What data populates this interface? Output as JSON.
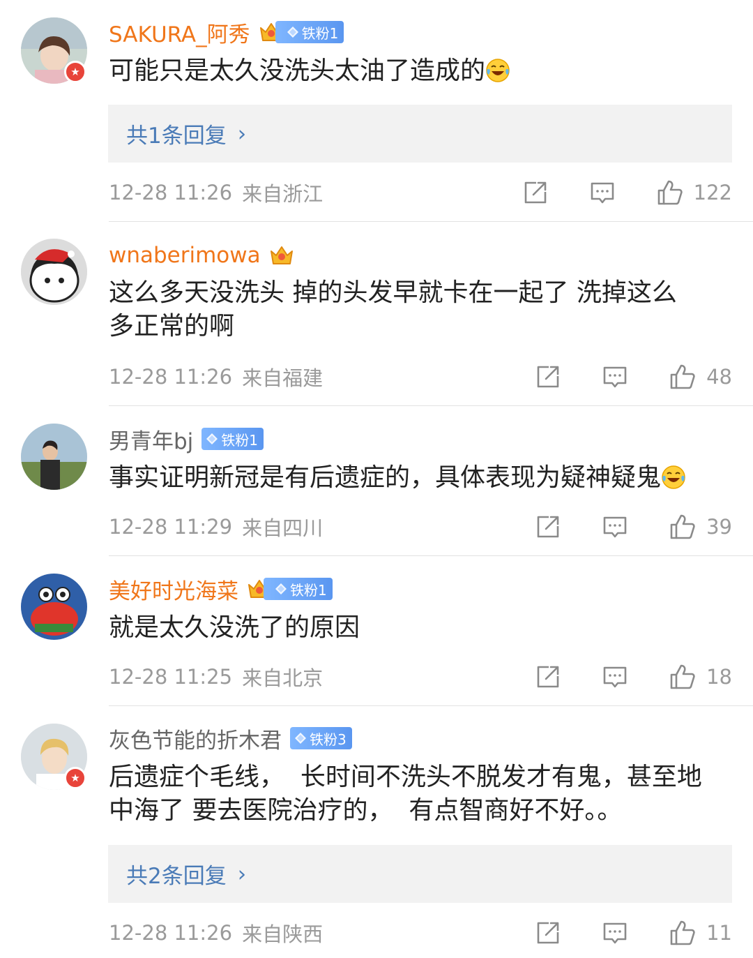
{
  "comments": [
    {
      "username": "SAKURA_阿秀",
      "name_style": "vip",
      "crown_level": "7",
      "fan_badge": "铁粉1",
      "verified": true,
      "text": "可能只是太久没洗头太油了造成的",
      "emoji": "laugh-cry-emoji",
      "reply_label": "共1条回复",
      "time": "12-28 11:26",
      "location": "来自浙江",
      "likes": "122"
    },
    {
      "username": "wnaberimowa",
      "name_style": "vip",
      "crown_level": "2",
      "fan_badge": "",
      "verified": false,
      "text_line1": "这么多天没洗头 掉的头发早就卡在一起了 洗掉这么",
      "text_line2": "多正常的啊",
      "time": "12-28 11:26",
      "location": "来自福建",
      "likes": "48"
    },
    {
      "username": "男青年bj",
      "name_style": "plain",
      "fan_badge": "铁粉1",
      "verified": false,
      "text": "事实证明新冠是有后遗症的，具体表现为疑神疑鬼",
      "emoji": "laugh-cry-emoji",
      "time": "12-28 11:29",
      "location": "来自四川",
      "likes": "39"
    },
    {
      "username": "美好时光海菜",
      "name_style": "vip",
      "crown_level": "6",
      "fan_badge": "铁粉1",
      "verified": false,
      "text": "就是太久没洗了的原因",
      "time": "12-28 11:25",
      "location": "来自北京",
      "likes": "18"
    },
    {
      "username": "灰色节能的折木君",
      "name_style": "plain",
      "fan_badge": "铁粉3",
      "verified": true,
      "text_line1": "后遗症个毛线，  长时间不洗头不脱发才有鬼，甚至地",
      "text_line2": "中海了 要去医院治疗的，  有点智商好不好。。",
      "reply_label": "共2条回复",
      "time": "12-28 11:26",
      "location": "来自陕西",
      "likes": "11"
    }
  ],
  "colors": {
    "vip_name": "#f0761a",
    "plain_name": "#666666",
    "reply_link": "#4a7bb7",
    "meta": "#9a9a9a",
    "verified_badge": "#e8443a",
    "fan_badge": "#6aa5f7"
  },
  "icons": {
    "share": "share-icon",
    "comment": "comment-icon",
    "like": "thumbs-up-icon",
    "reply_chevron": "›"
  }
}
